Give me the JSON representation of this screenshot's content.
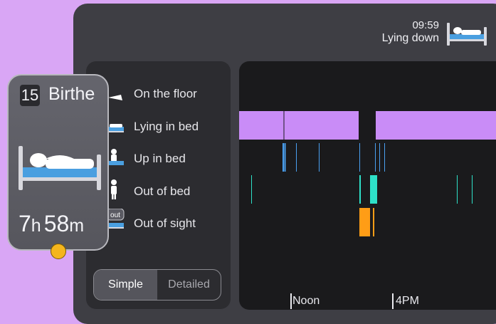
{
  "header": {
    "time": "09:59",
    "status": "Lying down",
    "status_icon": "bed-lying-icon"
  },
  "legend": {
    "items": [
      {
        "label": "On the floor",
        "icon": "on-floor-icon"
      },
      {
        "label": "Lying in bed",
        "icon": "lying-in-bed-icon"
      },
      {
        "label": "Up in bed",
        "icon": "up-in-bed-icon"
      },
      {
        "label": "Out of bed",
        "icon": "out-of-bed-icon"
      },
      {
        "label": "Out of sight",
        "icon": "out-of-sight-icon",
        "badge": "out"
      }
    ]
  },
  "toggle": {
    "options": [
      "Simple",
      "Detailed"
    ],
    "selected": "Simple"
  },
  "card": {
    "room_number": "15",
    "name": "Birthe",
    "hours": "7",
    "hours_unit": "h",
    "minutes": "58",
    "minutes_unit": "m",
    "status_icon": "bed-lying-icon",
    "alert_color": "#f4b51d"
  },
  "timeline": {
    "tick_labels": [
      "Noon",
      "4PM"
    ],
    "colors": {
      "lying_in_bed": "#c98cf7",
      "up_in_bed": "#4aa0f0",
      "out_of_bed": "#2ee0c8",
      "out_of_sight": "#ff9d16"
    }
  }
}
